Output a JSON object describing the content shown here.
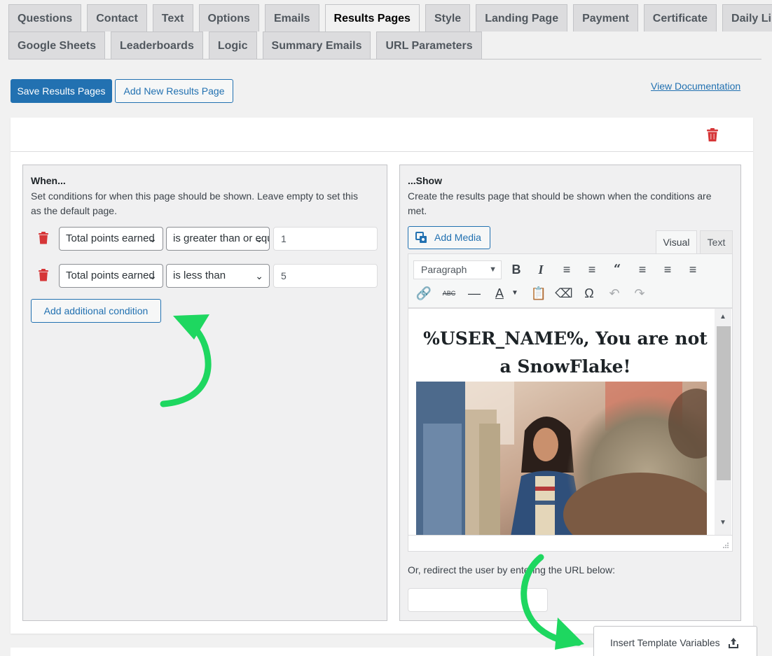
{
  "tabs": {
    "row1": [
      "Questions",
      "Contact",
      "Text",
      "Options",
      "Emails",
      "Results Pages",
      "Style",
      "Landing Page",
      "Payment",
      "Certificate",
      "Daily Limit"
    ],
    "row2": [
      "Google Sheets",
      "Leaderboards",
      "Logic",
      "Summary Emails",
      "URL Parameters"
    ],
    "active": "Results Pages"
  },
  "actions": {
    "save_label": "Save Results Pages",
    "add_label": "Add New Results Page",
    "doc_label": "View Documentation"
  },
  "when_panel": {
    "title": "When...",
    "description_line1": "Set conditions for when this page should be shown. Leave empty to set this",
    "description_line2": "as the default page.",
    "conditions": [
      {
        "field": "Total points earned",
        "operator": "is greater than or equal to",
        "value": "1"
      },
      {
        "field": "Total points earned",
        "operator": "is less than",
        "value": "5"
      }
    ],
    "add_condition_label": "Add additional condition"
  },
  "show_panel": {
    "title": "...Show",
    "description_line1": "Create the results page that should be shown when the conditions are",
    "description_line2": "met.",
    "add_media_label": "Add Media",
    "editor_tabs": [
      "Visual",
      "Text"
    ],
    "format_select": "Paragraph",
    "content_heading_line1": "%USER_NAME%, You are not",
    "content_heading_line2": "a SnowFlake!",
    "redirect_label": "Or, redirect the user by entering the URL below:",
    "redirect_value": ""
  },
  "insert_variables_label": "Insert Template Variables",
  "colors": {
    "primary": "#2271b1",
    "danger": "#d63638",
    "arrow": "#1ed760",
    "panel_bg": "#f0f0f1"
  }
}
